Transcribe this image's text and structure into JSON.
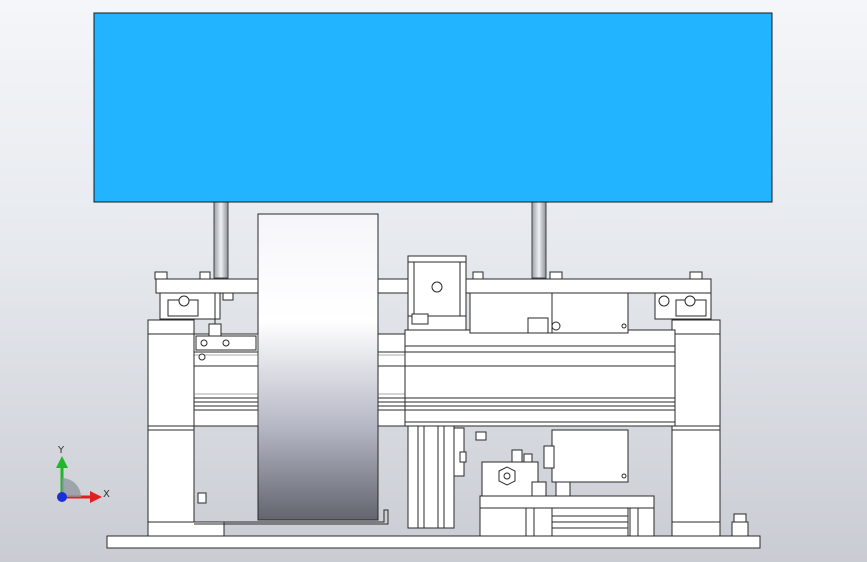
{
  "colors": {
    "panel": "#22b4ff",
    "axis_x": "#e02020",
    "axis_y": "#1fb82a",
    "axis_z": "#1b2fd6"
  },
  "triad": {
    "x_label": "X",
    "y_label": "Y"
  }
}
